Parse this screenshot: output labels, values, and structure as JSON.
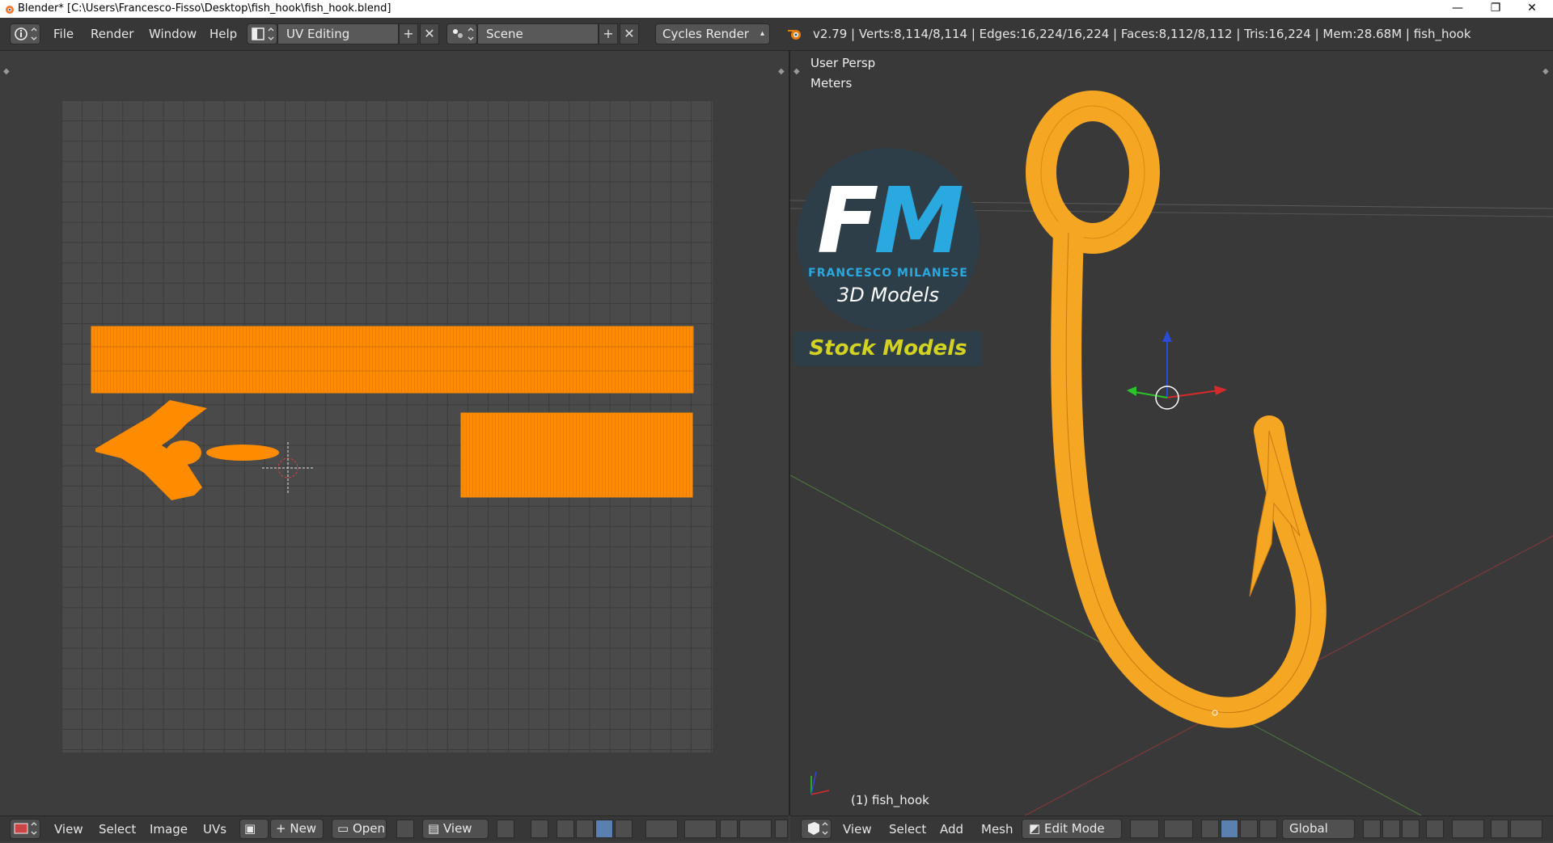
{
  "window": {
    "title": "Blender* [C:\\Users\\Francesco-Fisso\\Desktop\\fish_hook\\fish_hook.blend]",
    "minimize": "—",
    "maximize": "❐",
    "close": "✕"
  },
  "infobar": {
    "menus": [
      "File",
      "Render",
      "Window",
      "Help"
    ],
    "screen_layout": "UV Editing",
    "scene": "Scene",
    "render_engine": "Cycles Render",
    "stats": "v2.79 | Verts:8,114/8,114 | Edges:16,224/16,224 | Faces:8,112/8,112 | Tris:16,224 | Mem:28.68M | fish_hook"
  },
  "uv_editor": {
    "header": {
      "menus": [
        "View",
        "Select",
        "Image",
        "UVs"
      ],
      "new_label": "New",
      "open_label": "Open",
      "view_label": "View"
    }
  },
  "viewport": {
    "view_name": "User Persp",
    "units": "Meters",
    "object_label": "(1) fish_hook",
    "logo": {
      "f": "F",
      "m": "M",
      "name": "FRANCESCO MILANESE",
      "subtitle": "3D Models",
      "badge": "Stock Models"
    },
    "header": {
      "menus": [
        "View",
        "Select",
        "Add",
        "Mesh"
      ],
      "mode": "Edit Mode",
      "orientation": "Global"
    }
  },
  "colors": {
    "accent_orange": "#ff8c00",
    "mesh_orange": "#f5a623",
    "logo_blue": "#2aa9e0",
    "logo_yellow": "#d4d221"
  }
}
